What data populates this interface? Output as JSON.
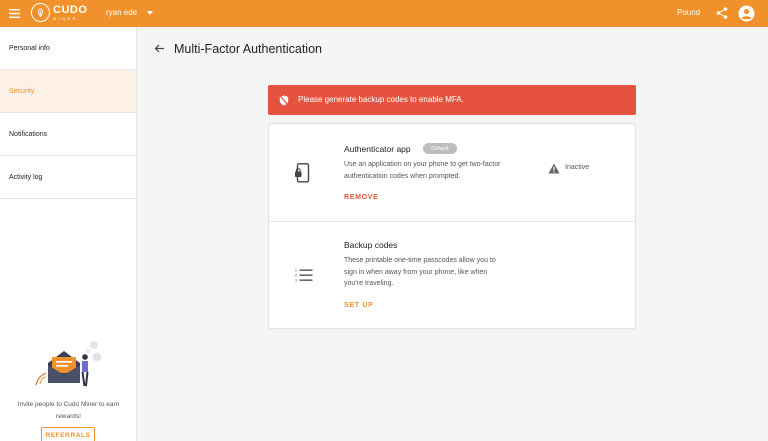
{
  "topbar": {
    "logo_text": "CUDO",
    "logo_subtext": "MINER",
    "username": "ryan ede",
    "currency": "Pound",
    "bg_color": "#f0912c"
  },
  "sidebar": {
    "items": [
      {
        "label": "Personal info",
        "active": false
      },
      {
        "label": "Security",
        "active": true
      },
      {
        "label": "Notifications",
        "active": false
      },
      {
        "label": "Activity log",
        "active": false
      }
    ],
    "promo_text": "Invite people to Cudo Miner to earn rewards!",
    "referrals_label": "REFERRALS"
  },
  "page": {
    "title": "Multi-Factor Authentication"
  },
  "alert": {
    "text": "Please generate backup codes to enable MFA.",
    "color": "#e5533f"
  },
  "methods": {
    "authenticator": {
      "title": "Authenticator app",
      "badge": "Default",
      "description": "Use an application on your phone to get two-factor authentication codes when prompted.",
      "action": "REMOVE",
      "status": "Inactive"
    },
    "backup": {
      "title": "Backup codes",
      "description": "These printable one-time passcodes allow you to sign in when away from your phone, like when you’re traveling.",
      "action": "SET UP"
    }
  },
  "icons": {
    "menu": "menu-icon",
    "share": "share-icon",
    "account": "account-circle-icon",
    "back": "arrow-left-icon",
    "alert": "shield-off-icon",
    "phone": "phone-lock-icon",
    "warning": "warning-icon",
    "list": "numbered-list-icon"
  }
}
